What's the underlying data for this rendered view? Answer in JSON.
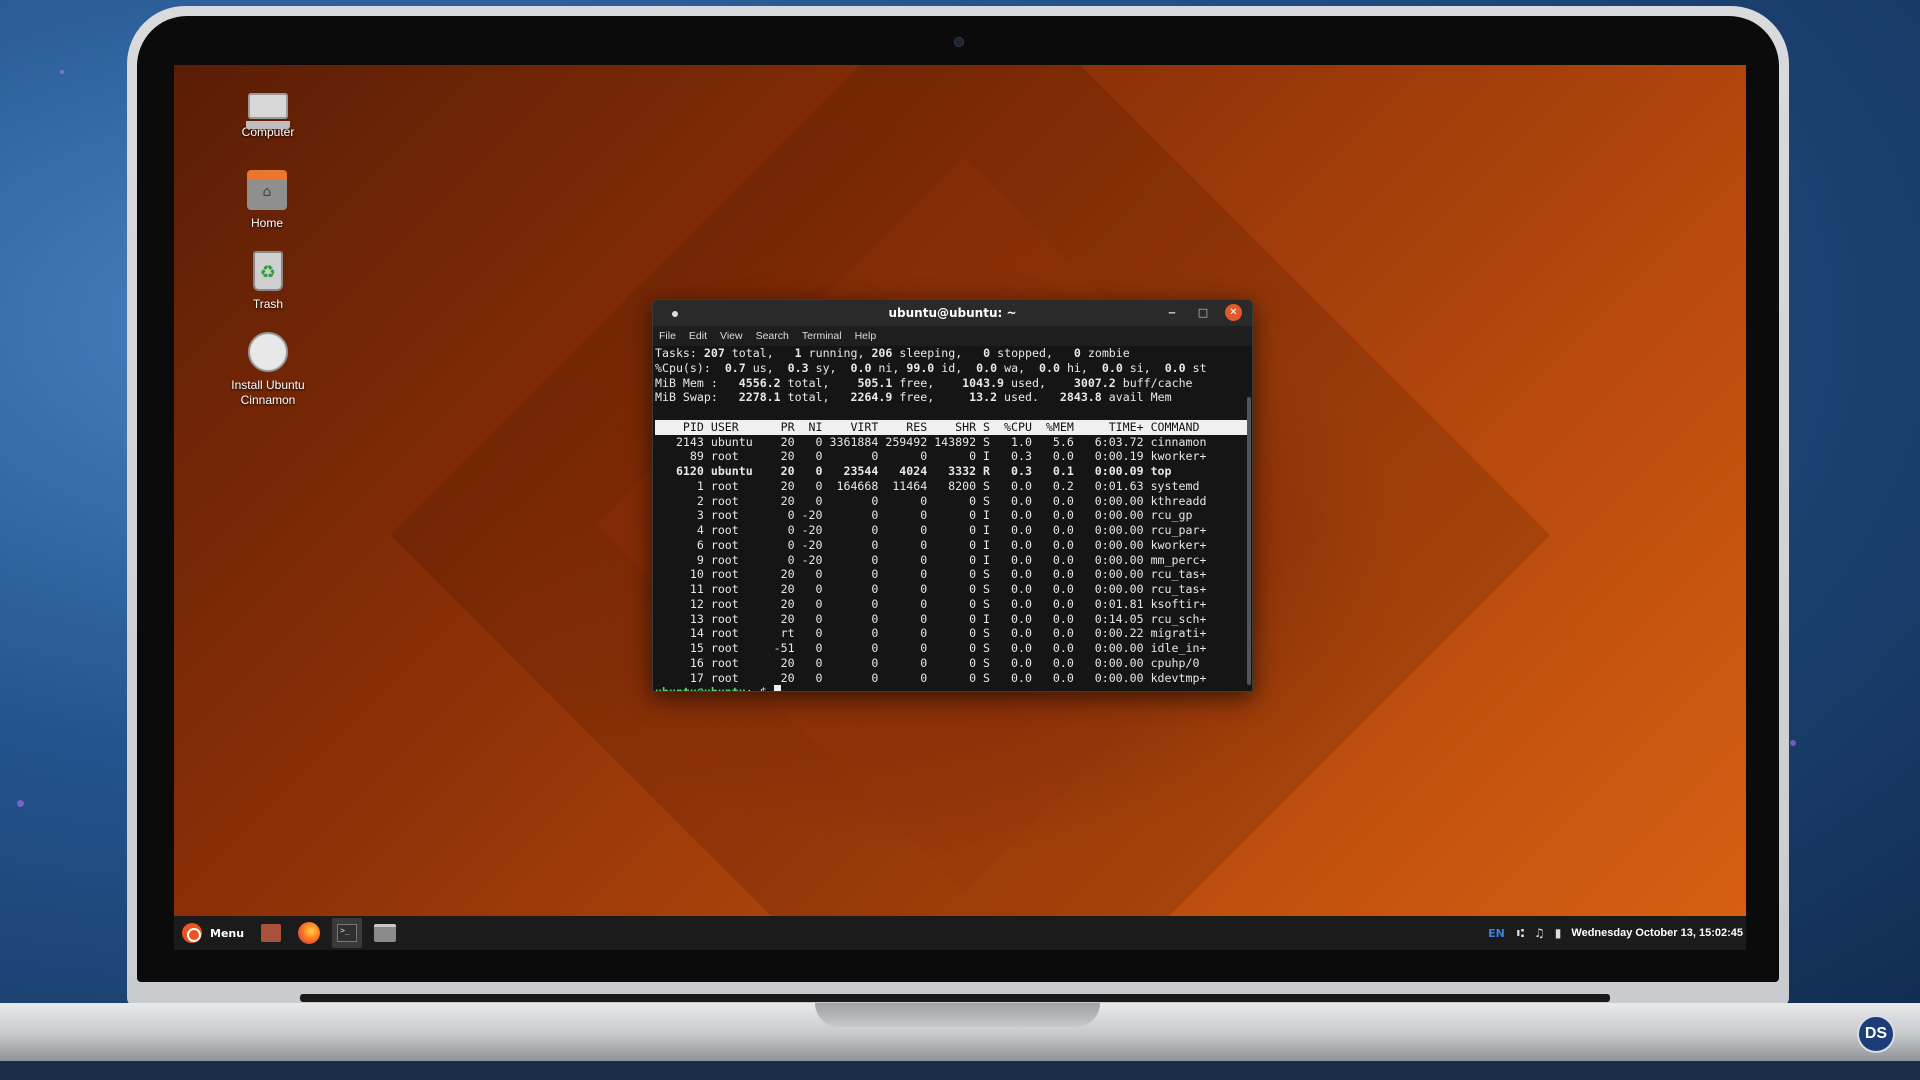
{
  "desktop": {
    "icons": [
      {
        "label": "Computer"
      },
      {
        "label": "Home"
      },
      {
        "label": "Trash"
      },
      {
        "label": "Install Ubuntu Cinnamon"
      }
    ]
  },
  "terminal": {
    "title": "ubuntu@ubuntu: ~",
    "menu": [
      "File",
      "Edit",
      "View",
      "Search",
      "Terminal",
      "Help"
    ],
    "summary": {
      "tasks": {
        "total": "207",
        "running": "1",
        "sleeping": "206",
        "stopped": "0",
        "zombie": "0"
      },
      "cpu": {
        "us": "0.7",
        "sy": "0.3",
        "ni": "0.0",
        "id": "99.0",
        "wa": "0.0",
        "hi": "0.0",
        "si": "0.0",
        "st": "0.0"
      },
      "mem": {
        "total": "4556.2",
        "free": "505.1",
        "used": "1043.9",
        "buff_cache": "3007.2"
      },
      "swap": {
        "total": "2278.1",
        "free": "2264.9",
        "used": "13.2",
        "avail_mem": "2843.8"
      }
    },
    "columns": [
      "PID",
      "USER",
      "PR",
      "NI",
      "VIRT",
      "RES",
      "SHR",
      "S",
      "%CPU",
      "%MEM",
      "TIME+",
      "COMMAND"
    ],
    "processes": [
      [
        "2143",
        "ubuntu",
        "20",
        "0",
        "3361884",
        "259492",
        "143892",
        "S",
        "1.0",
        "5.6",
        "6:03.72",
        "cinnamon",
        false
      ],
      [
        "89",
        "root",
        "20",
        "0",
        "0",
        "0",
        "0",
        "I",
        "0.3",
        "0.0",
        "0:00.19",
        "kworker+",
        false
      ],
      [
        "6120",
        "ubuntu",
        "20",
        "0",
        "23544",
        "4024",
        "3332",
        "R",
        "0.3",
        "0.1",
        "0:00.09",
        "top",
        true
      ],
      [
        "1",
        "root",
        "20",
        "0",
        "164668",
        "11464",
        "8200",
        "S",
        "0.0",
        "0.2",
        "0:01.63",
        "systemd",
        false
      ],
      [
        "2",
        "root",
        "20",
        "0",
        "0",
        "0",
        "0",
        "S",
        "0.0",
        "0.0",
        "0:00.00",
        "kthreadd",
        false
      ],
      [
        "3",
        "root",
        "0",
        "-20",
        "0",
        "0",
        "0",
        "I",
        "0.0",
        "0.0",
        "0:00.00",
        "rcu_gp",
        false
      ],
      [
        "4",
        "root",
        "0",
        "-20",
        "0",
        "0",
        "0",
        "I",
        "0.0",
        "0.0",
        "0:00.00",
        "rcu_par+",
        false
      ],
      [
        "6",
        "root",
        "0",
        "-20",
        "0",
        "0",
        "0",
        "I",
        "0.0",
        "0.0",
        "0:00.00",
        "kworker+",
        false
      ],
      [
        "9",
        "root",
        "0",
        "-20",
        "0",
        "0",
        "0",
        "I",
        "0.0",
        "0.0",
        "0:00.00",
        "mm_perc+",
        false
      ],
      [
        "10",
        "root",
        "20",
        "0",
        "0",
        "0",
        "0",
        "S",
        "0.0",
        "0.0",
        "0:00.00",
        "rcu_tas+",
        false
      ],
      [
        "11",
        "root",
        "20",
        "0",
        "0",
        "0",
        "0",
        "S",
        "0.0",
        "0.0",
        "0:00.00",
        "rcu_tas+",
        false
      ],
      [
        "12",
        "root",
        "20",
        "0",
        "0",
        "0",
        "0",
        "S",
        "0.0",
        "0.0",
        "0:01.81",
        "ksoftir+",
        false
      ],
      [
        "13",
        "root",
        "20",
        "0",
        "0",
        "0",
        "0",
        "I",
        "0.0",
        "0.0",
        "0:14.05",
        "rcu_sch+",
        false
      ],
      [
        "14",
        "root",
        "rt",
        "0",
        "0",
        "0",
        "0",
        "S",
        "0.0",
        "0.0",
        "0:00.22",
        "migrati+",
        false
      ],
      [
        "15",
        "root",
        "-51",
        "0",
        "0",
        "0",
        "0",
        "S",
        "0.0",
        "0.0",
        "0:00.00",
        "idle_in+",
        false
      ],
      [
        "16",
        "root",
        "20",
        "0",
        "0",
        "0",
        "0",
        "S",
        "0.0",
        "0.0",
        "0:00.00",
        "cpuhp/0",
        false
      ],
      [
        "17",
        "root",
        "20",
        "0",
        "0",
        "0",
        "0",
        "S",
        "0.0",
        "0.0",
        "0:00.00",
        "kdevtmp+",
        false
      ]
    ],
    "prompt": {
      "user_host": "ubuntu@ubuntu",
      "path_symbol": ": $ "
    }
  },
  "taskbar": {
    "menu_label": "Menu",
    "apps": [
      "files-icon",
      "firefox-icon",
      "terminal-icon",
      "folder-icon"
    ],
    "tray": {
      "lang": "EN",
      "clock": "Wednesday October 13, 15:02:45"
    }
  },
  "badge": {
    "text": "DS"
  }
}
